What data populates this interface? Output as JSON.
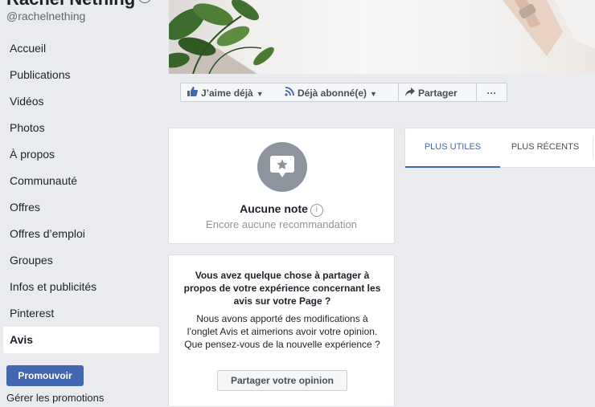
{
  "sidebar": {
    "page_name": "Rachel Nething",
    "handle": "@rachelnething",
    "items": [
      {
        "label": "Accueil"
      },
      {
        "label": "Publications"
      },
      {
        "label": "Vidéos"
      },
      {
        "label": "Photos"
      },
      {
        "label": "À propos"
      },
      {
        "label": "Communauté"
      },
      {
        "label": "Offres"
      },
      {
        "label": "Offres d’emploi"
      },
      {
        "label": "Groupes"
      },
      {
        "label": "Infos et publicités"
      },
      {
        "label": "Pinterest"
      },
      {
        "label": "Avis"
      }
    ],
    "active_item": "Avis",
    "promote_label": "Promouvoir",
    "cut_text": "Gérer les promotions"
  },
  "actions": {
    "like_label": "J’aime déjà",
    "follow_label": "Déjà abonné(e)",
    "share_label": "Partager",
    "more_label": "···"
  },
  "rating": {
    "title": "Aucune note",
    "subtitle": "Encore aucune recommandation"
  },
  "feedback": {
    "title": "Vous avez quelque chose à partager à propos de votre expérience concernant les avis sur votre Page ?",
    "body": "Nous avons apporté des modifications à l’onglet Avis et aimerions avoir votre opinion. Que pensez-vous de la nouvelle expérience ?",
    "button_label": "Partager votre opinion"
  },
  "tabs": {
    "useful": "PLUS UTILES",
    "recent": "PLUS RÉCENTS"
  },
  "colors": {
    "accent": "#4267b2",
    "background": "#e9ebee",
    "bubble": "#8d949e"
  },
  "icons": [
    "verified-badge-icon",
    "thumbs-up-icon",
    "rss-feed-icon",
    "share-arrow-icon",
    "more-dots-icon",
    "star-speech-bubble-icon",
    "info-icon"
  ]
}
